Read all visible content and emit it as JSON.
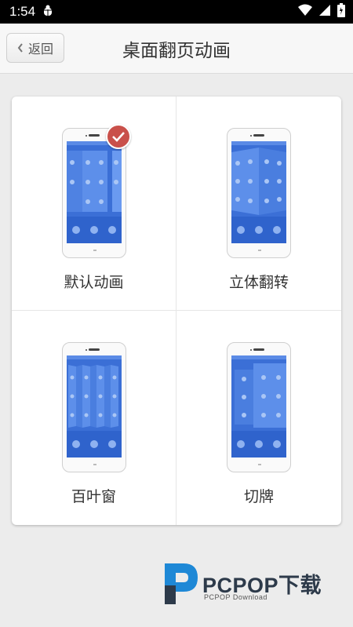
{
  "status_bar": {
    "time": "1:54",
    "icons": [
      "bug-icon",
      "wifi-icon",
      "signal-icon",
      "battery-icon"
    ]
  },
  "header": {
    "back_label": "返回",
    "title": "桌面翻页动画"
  },
  "options": [
    {
      "label": "默认动画",
      "selected": true,
      "style": "default"
    },
    {
      "label": "立体翻转",
      "selected": false,
      "style": "cube"
    },
    {
      "label": "百叶窗",
      "selected": false,
      "style": "blinds"
    },
    {
      "label": "切牌",
      "selected": false,
      "style": "card-cut"
    }
  ],
  "watermark": {
    "brand": "PCPOP下载",
    "sub": "PCPOP Download"
  },
  "colors": {
    "screen_blue": "#3b6fd6",
    "badge_red": "#c9504a",
    "brand_blue": "#1e88d6"
  }
}
